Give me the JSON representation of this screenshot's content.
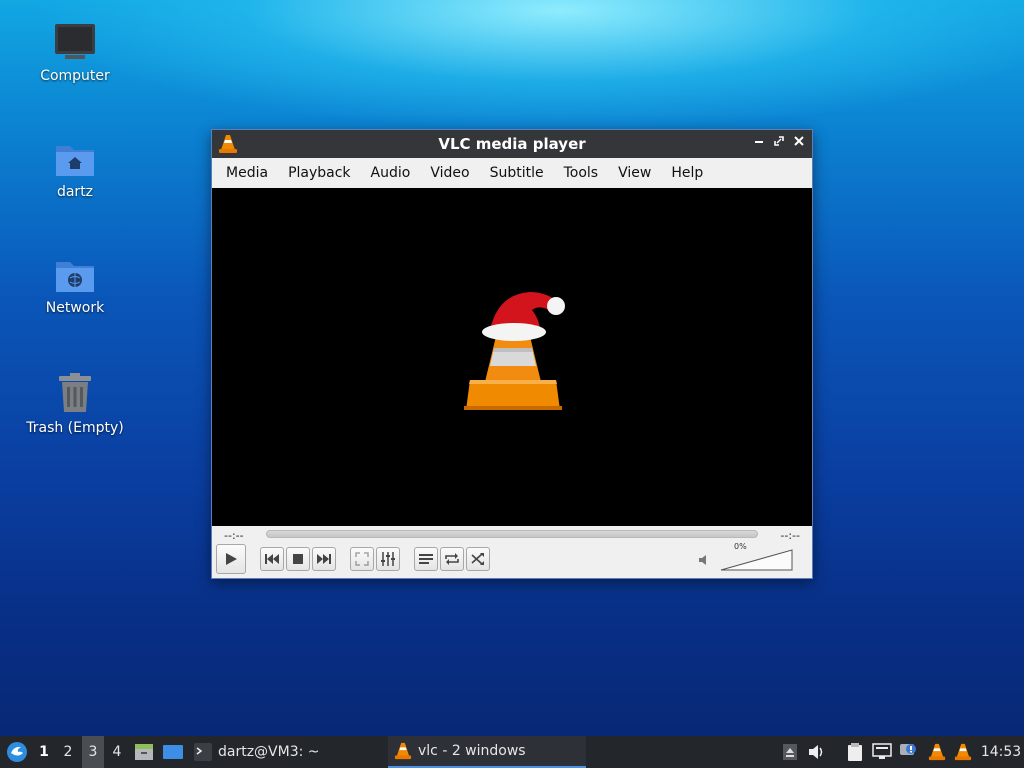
{
  "desktop": {
    "icons": [
      {
        "label": "Computer"
      },
      {
        "label": "dartz"
      },
      {
        "label": "Network"
      },
      {
        "label": "Trash (Empty)"
      }
    ]
  },
  "window": {
    "title": "VLC media player",
    "menu": [
      "Media",
      "Playback",
      "Audio",
      "Video",
      "Subtitle",
      "Tools",
      "View",
      "Help"
    ],
    "time_elapsed": "--:--",
    "time_total": "--:--",
    "volume_percent": "0%"
  },
  "taskbar": {
    "workspaces": [
      "1",
      "2",
      "3",
      "4"
    ],
    "terminal_task": "dartz@VM3: ~",
    "vlc_task": "vlc - 2 windows",
    "clock": "14:53"
  },
  "colors": {
    "titlebar": "#34363a",
    "taskbar": "#23262b",
    "accent": "#4d8fe0",
    "vlc_orange": "#f18a00"
  }
}
